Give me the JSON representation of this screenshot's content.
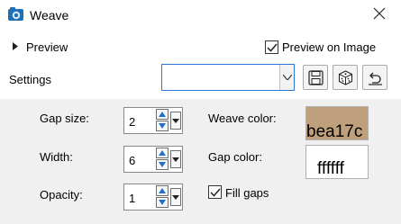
{
  "window": {
    "title": "Weave",
    "icon": "camera-app-icon"
  },
  "preview": {
    "label": "Preview",
    "preview_on_image_label": "Preview on Image",
    "preview_on_image_checked": true
  },
  "settings": {
    "label": "Settings",
    "preset_value": ""
  },
  "fields": {
    "gap_size": {
      "label": "Gap size:",
      "value": "2"
    },
    "width": {
      "label": "Width:",
      "value": "6"
    },
    "opacity": {
      "label": "Opacity:",
      "value": "1"
    },
    "weave_color": {
      "label": "Weave color:",
      "code": "bea17c",
      "hex": "#bea17c"
    },
    "gap_color": {
      "label": "Gap color:",
      "code": "ffffff",
      "hex": "#ffffff"
    },
    "fill_gaps": {
      "label": "Fill gaps",
      "checked": true
    }
  },
  "colors": {
    "accent": "#2b79d6",
    "panel_bg": "#f0f0f0",
    "spinner_arrow": "#1e73c9"
  }
}
